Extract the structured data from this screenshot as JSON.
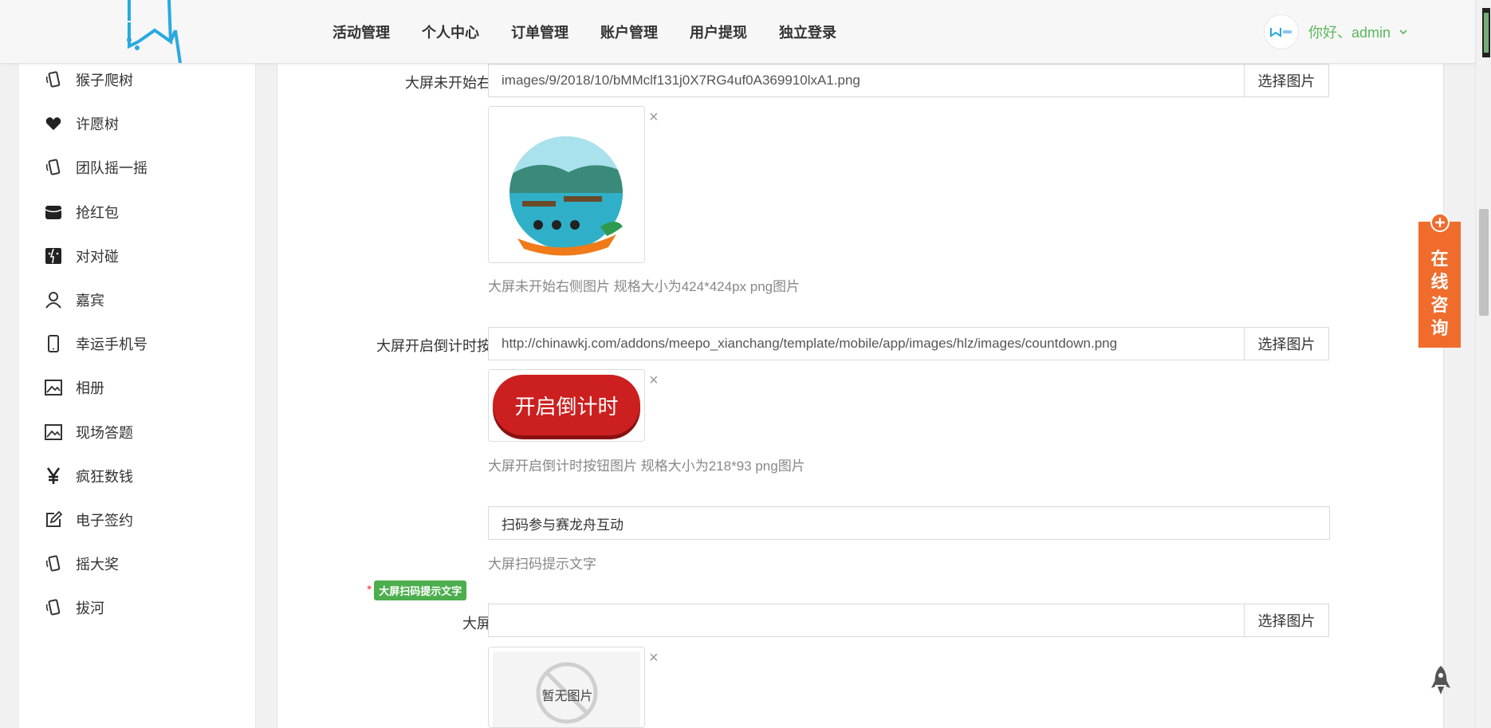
{
  "header": {
    "nav": [
      "活动管理",
      "个人中心",
      "订单管理",
      "账户管理",
      "用户提现",
      "独立登录"
    ],
    "greeting": "你好、admin"
  },
  "sidebar": {
    "items": [
      {
        "label": "猴子爬树",
        "icon": "phone-shake-icon"
      },
      {
        "label": "许愿树",
        "icon": "heart-icon"
      },
      {
        "label": "团队摇一摇",
        "icon": "phone-shake-icon"
      },
      {
        "label": "抢红包",
        "icon": "wallet-icon"
      },
      {
        "label": "对对碰",
        "icon": "finder-icon"
      },
      {
        "label": "嘉宾",
        "icon": "user-icon"
      },
      {
        "label": "幸运手机号",
        "icon": "mobile-icon"
      },
      {
        "label": "相册",
        "icon": "image-icon"
      },
      {
        "label": "现场答题",
        "icon": "image-icon"
      },
      {
        "label": "疯狂数钱",
        "icon": "yen-icon"
      },
      {
        "label": "电子签约",
        "icon": "edit-icon"
      },
      {
        "label": "摇大奖",
        "icon": "phone-shake-icon"
      },
      {
        "label": "拔河",
        "icon": "phone-shake-icon"
      }
    ]
  },
  "form": {
    "right_image": {
      "label": "大屏未开始右侧图片",
      "value": "images/9/2018/10/bMMclf131j0X7RG4uf0A369910lxA1.png",
      "button": "选择图片",
      "hint": "大屏未开始右侧图片 规格大小为424*424px png图片"
    },
    "countdown_button": {
      "label": "大屏开启倒计时按钮图片",
      "value": "http://chinawkj.com/addons/meepo_xianchang/template/mobile/app/images/hlz/images/countdown.png",
      "button": "选择图片",
      "preview_text": "开启倒计时",
      "hint": "大屏开启倒计时按钮图片 规格大小为218*93 png图片"
    },
    "scan_tip": {
      "required_mark": "*",
      "badge": "大屏扫码提示文字",
      "value": "扫码参与赛龙舟互动",
      "hint": "大屏扫码提示文字"
    },
    "qrcode": {
      "label": "大屏二维码",
      "value": "",
      "button": "选择图片",
      "empty_text": "暂无图片"
    },
    "remove_symbol": "×"
  },
  "consult": {
    "text": "在线咨询"
  },
  "colors": {
    "accent_green": "#5cb85c",
    "consult_orange": "#f06c2c",
    "countdown_red": "#cc1f1f"
  }
}
